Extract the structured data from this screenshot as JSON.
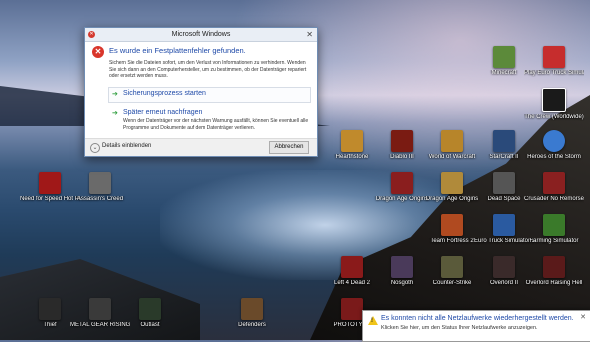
{
  "dialog": {
    "title": "Microsoft Windows",
    "close_glyph": "✕",
    "heading": "Es wurde ein Festplattenfehler gefunden.",
    "description": "Sichern Sie die Dateien sofort, um den Verlust von Informationen zu verhindern. Wenden Sie sich dann an den Computerhersteller, um zu bestimmen, ob der Datenträger repariert oder ersetzt werden muss.",
    "option_primary": "Sicherungsprozess starten",
    "option_secondary": "Später erneut nachfragen",
    "option_secondary_desc": "Wenn der Datenträger vor der nächsten Warnung ausfällt, können Sie eventuell alle Programme und Dokumente auf dem Datenträger verlieren.",
    "details_label": "Details einblenden",
    "cancel_label": "Abbrechen",
    "option_arrow": "➔"
  },
  "notification": {
    "title": "Es konnten nicht alle Netzlaufwerke wiederhergestellt werden.",
    "body": "Klicken Sie hier, um den Status Ihrer Netzlaufwerke anzuzeigen.",
    "close_glyph": "✕",
    "warn_glyph": "!"
  },
  "desktop_icons": [
    {
      "label": "Minecraft",
      "color": "#5c8a3a"
    },
    {
      "label": "Play Euro Truck Simulator 2 Multiplayer",
      "color": "#c62d2d"
    },
    {
      "label": "The Crew (Worldwide)",
      "color": "#1a1a1a"
    },
    {
      "label": "Hearthstone",
      "color": "#c08a2c"
    },
    {
      "label": "Diablo III",
      "color": "#7a1b12"
    },
    {
      "label": "World of Warcraft",
      "color": "#b7852a"
    },
    {
      "label": "StarCraft II",
      "color": "#2a4a7a"
    },
    {
      "label": "Heroes of the Storm",
      "color": "#3a7ad0"
    },
    {
      "label": "Need for Speed Hot Pursuit",
      "color": "#a01818"
    },
    {
      "label": "Assassin's Creed",
      "color": "#6a6a6a"
    },
    {
      "label": "Dragon Age Origins",
      "color": "#8a1e1e"
    },
    {
      "label": "Dragon Age Origins",
      "color": "#b08a3a"
    },
    {
      "label": "Dead Space",
      "color": "#555555"
    },
    {
      "label": "Crusader No Remorse",
      "color": "#8a2020"
    },
    {
      "label": "Team Fortress 2",
      "color": "#b04a20"
    },
    {
      "label": "Euro Truck Simulator 2",
      "color": "#2a5aa0"
    },
    {
      "label": "Farming Simulator",
      "color": "#3a7a2a"
    },
    {
      "label": "Left 4 Dead 2",
      "color": "#8a1a1a"
    },
    {
      "label": "Nosgoth",
      "color": "#4a3a5a"
    },
    {
      "label": "Counter-Strike",
      "color": "#5a5a3a"
    },
    {
      "label": "Overlord II",
      "color": "#3a2a2a"
    },
    {
      "label": "Overlord Raising Hell",
      "color": "#5a1a1a"
    },
    {
      "label": "Thief",
      "color": "#2a2a2a"
    },
    {
      "label": "METAL GEAR RISING REVENGEANCE",
      "color": "#3a3a3a"
    },
    {
      "label": "Outlast",
      "color": "#2a3a2a"
    },
    {
      "label": "Defenders",
      "color": "#6a4a2a"
    },
    {
      "label": "PROTOTYPE",
      "color": "#7a1a1a"
    }
  ]
}
